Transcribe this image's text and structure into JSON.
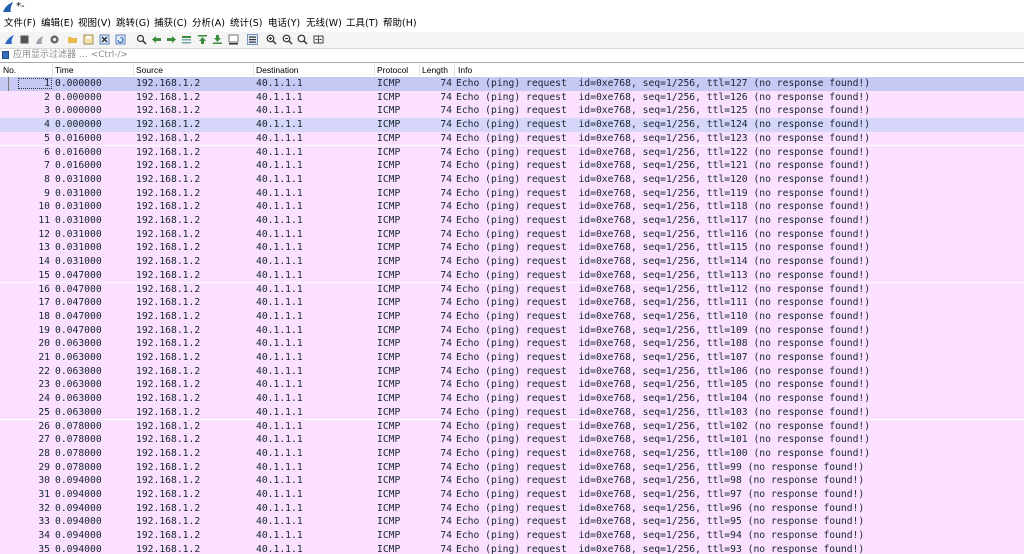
{
  "window": {
    "title": "*-"
  },
  "menu": [
    "文件(F)",
    "编辑(E)",
    "视图(V)",
    "跳转(G)",
    "捕获(C)",
    "分析(A)",
    "统计(S)",
    "电话(Y)",
    "无线(W)",
    "工具(T)",
    "帮助(H)"
  ],
  "toolbar": {
    "icons": [
      "shark-fin-start-icon",
      "stop-icon",
      "restart-icon",
      "options-gear-icon",
      "open-folder-icon",
      "save-icon",
      "close-file-icon",
      "reload-icon",
      "find-icon",
      "go-back-icon",
      "go-forward-icon",
      "go-to-packet-icon",
      "first-packet-icon",
      "last-packet-icon",
      "autoscroll-icon",
      "colorize-icon",
      "zoom-in-icon",
      "zoom-out-icon",
      "normal-size-icon",
      "resize-columns-icon"
    ]
  },
  "filter": {
    "placeholder": "应用显示过滤器 … <Ctrl-/>"
  },
  "columns": {
    "no": "No.",
    "time": "Time",
    "source": "Source",
    "destination": "Destination",
    "protocol": "Protocol",
    "length": "Length",
    "info": "Info"
  },
  "packets": [
    {
      "no": "1",
      "time": "0.000000",
      "src": "192.168.1.2",
      "dst": "40.1.1.1",
      "proto": "ICMP",
      "len": "74",
      "info": "Echo (ping) request  id=0xe768, seq=1/256, ttl=127 (no response found!)"
    },
    {
      "no": "2",
      "time": "0.000000",
      "src": "192.168.1.2",
      "dst": "40.1.1.1",
      "proto": "ICMP",
      "len": "74",
      "info": "Echo (ping) request  id=0xe768, seq=1/256, ttl=126 (no response found!)"
    },
    {
      "no": "3",
      "time": "0.000000",
      "src": "192.168.1.2",
      "dst": "40.1.1.1",
      "proto": "ICMP",
      "len": "74",
      "info": "Echo (ping) request  id=0xe768, seq=1/256, ttl=125 (no response found!)"
    },
    {
      "no": "4",
      "time": "0.000000",
      "src": "192.168.1.2",
      "dst": "40.1.1.1",
      "proto": "ICMP",
      "len": "74",
      "info": "Echo (ping) request  id=0xe768, seq=1/256, ttl=124 (no response found!)"
    },
    {
      "no": "5",
      "time": "0.016000",
      "src": "192.168.1.2",
      "dst": "40.1.1.1",
      "proto": "ICMP",
      "len": "74",
      "info": "Echo (ping) request  id=0xe768, seq=1/256, ttl=123 (no response found!)"
    },
    {
      "no": "6",
      "time": "0.016000",
      "src": "192.168.1.2",
      "dst": "40.1.1.1",
      "proto": "ICMP",
      "len": "74",
      "info": "Echo (ping) request  id=0xe768, seq=1/256, ttl=122 (no response found!)"
    },
    {
      "no": "7",
      "time": "0.016000",
      "src": "192.168.1.2",
      "dst": "40.1.1.1",
      "proto": "ICMP",
      "len": "74",
      "info": "Echo (ping) request  id=0xe768, seq=1/256, ttl=121 (no response found!)"
    },
    {
      "no": "8",
      "time": "0.031000",
      "src": "192.168.1.2",
      "dst": "40.1.1.1",
      "proto": "ICMP",
      "len": "74",
      "info": "Echo (ping) request  id=0xe768, seq=1/256, ttl=120 (no response found!)"
    },
    {
      "no": "9",
      "time": "0.031000",
      "src": "192.168.1.2",
      "dst": "40.1.1.1",
      "proto": "ICMP",
      "len": "74",
      "info": "Echo (ping) request  id=0xe768, seq=1/256, ttl=119 (no response found!)"
    },
    {
      "no": "10",
      "time": "0.031000",
      "src": "192.168.1.2",
      "dst": "40.1.1.1",
      "proto": "ICMP",
      "len": "74",
      "info": "Echo (ping) request  id=0xe768, seq=1/256, ttl=118 (no response found!)"
    },
    {
      "no": "11",
      "time": "0.031000",
      "src": "192.168.1.2",
      "dst": "40.1.1.1",
      "proto": "ICMP",
      "len": "74",
      "info": "Echo (ping) request  id=0xe768, seq=1/256, ttl=117 (no response found!)"
    },
    {
      "no": "12",
      "time": "0.031000",
      "src": "192.168.1.2",
      "dst": "40.1.1.1",
      "proto": "ICMP",
      "len": "74",
      "info": "Echo (ping) request  id=0xe768, seq=1/256, ttl=116 (no response found!)"
    },
    {
      "no": "13",
      "time": "0.031000",
      "src": "192.168.1.2",
      "dst": "40.1.1.1",
      "proto": "ICMP",
      "len": "74",
      "info": "Echo (ping) request  id=0xe768, seq=1/256, ttl=115 (no response found!)"
    },
    {
      "no": "14",
      "time": "0.031000",
      "src": "192.168.1.2",
      "dst": "40.1.1.1",
      "proto": "ICMP",
      "len": "74",
      "info": "Echo (ping) request  id=0xe768, seq=1/256, ttl=114 (no response found!)"
    },
    {
      "no": "15",
      "time": "0.047000",
      "src": "192.168.1.2",
      "dst": "40.1.1.1",
      "proto": "ICMP",
      "len": "74",
      "info": "Echo (ping) request  id=0xe768, seq=1/256, ttl=113 (no response found!)"
    },
    {
      "no": "16",
      "time": "0.047000",
      "src": "192.168.1.2",
      "dst": "40.1.1.1",
      "proto": "ICMP",
      "len": "74",
      "info": "Echo (ping) request  id=0xe768, seq=1/256, ttl=112 (no response found!)"
    },
    {
      "no": "17",
      "time": "0.047000",
      "src": "192.168.1.2",
      "dst": "40.1.1.1",
      "proto": "ICMP",
      "len": "74",
      "info": "Echo (ping) request  id=0xe768, seq=1/256, ttl=111 (no response found!)"
    },
    {
      "no": "18",
      "time": "0.047000",
      "src": "192.168.1.2",
      "dst": "40.1.1.1",
      "proto": "ICMP",
      "len": "74",
      "info": "Echo (ping) request  id=0xe768, seq=1/256, ttl=110 (no response found!)"
    },
    {
      "no": "19",
      "time": "0.047000",
      "src": "192.168.1.2",
      "dst": "40.1.1.1",
      "proto": "ICMP",
      "len": "74",
      "info": "Echo (ping) request  id=0xe768, seq=1/256, ttl=109 (no response found!)"
    },
    {
      "no": "20",
      "time": "0.063000",
      "src": "192.168.1.2",
      "dst": "40.1.1.1",
      "proto": "ICMP",
      "len": "74",
      "info": "Echo (ping) request  id=0xe768, seq=1/256, ttl=108 (no response found!)"
    },
    {
      "no": "21",
      "time": "0.063000",
      "src": "192.168.1.2",
      "dst": "40.1.1.1",
      "proto": "ICMP",
      "len": "74",
      "info": "Echo (ping) request  id=0xe768, seq=1/256, ttl=107 (no response found!)"
    },
    {
      "no": "22",
      "time": "0.063000",
      "src": "192.168.1.2",
      "dst": "40.1.1.1",
      "proto": "ICMP",
      "len": "74",
      "info": "Echo (ping) request  id=0xe768, seq=1/256, ttl=106 (no response found!)"
    },
    {
      "no": "23",
      "time": "0.063000",
      "src": "192.168.1.2",
      "dst": "40.1.1.1",
      "proto": "ICMP",
      "len": "74",
      "info": "Echo (ping) request  id=0xe768, seq=1/256, ttl=105 (no response found!)"
    },
    {
      "no": "24",
      "time": "0.063000",
      "src": "192.168.1.2",
      "dst": "40.1.1.1",
      "proto": "ICMP",
      "len": "74",
      "info": "Echo (ping) request  id=0xe768, seq=1/256, ttl=104 (no response found!)"
    },
    {
      "no": "25",
      "time": "0.063000",
      "src": "192.168.1.2",
      "dst": "40.1.1.1",
      "proto": "ICMP",
      "len": "74",
      "info": "Echo (ping) request  id=0xe768, seq=1/256, ttl=103 (no response found!)"
    },
    {
      "no": "26",
      "time": "0.078000",
      "src": "192.168.1.2",
      "dst": "40.1.1.1",
      "proto": "ICMP",
      "len": "74",
      "info": "Echo (ping) request  id=0xe768, seq=1/256, ttl=102 (no response found!)"
    },
    {
      "no": "27",
      "time": "0.078000",
      "src": "192.168.1.2",
      "dst": "40.1.1.1",
      "proto": "ICMP",
      "len": "74",
      "info": "Echo (ping) request  id=0xe768, seq=1/256, ttl=101 (no response found!)"
    },
    {
      "no": "28",
      "time": "0.078000",
      "src": "192.168.1.2",
      "dst": "40.1.1.1",
      "proto": "ICMP",
      "len": "74",
      "info": "Echo (ping) request  id=0xe768, seq=1/256, ttl=100 (no response found!)"
    },
    {
      "no": "29",
      "time": "0.078000",
      "src": "192.168.1.2",
      "dst": "40.1.1.1",
      "proto": "ICMP",
      "len": "74",
      "info": "Echo (ping) request  id=0xe768, seq=1/256, ttl=99 (no response found!)"
    },
    {
      "no": "30",
      "time": "0.094000",
      "src": "192.168.1.2",
      "dst": "40.1.1.1",
      "proto": "ICMP",
      "len": "74",
      "info": "Echo (ping) request  id=0xe768, seq=1/256, ttl=98 (no response found!)"
    },
    {
      "no": "31",
      "time": "0.094000",
      "src": "192.168.1.2",
      "dst": "40.1.1.1",
      "proto": "ICMP",
      "len": "74",
      "info": "Echo (ping) request  id=0xe768, seq=1/256, ttl=97 (no response found!)"
    },
    {
      "no": "32",
      "time": "0.094000",
      "src": "192.168.1.2",
      "dst": "40.1.1.1",
      "proto": "ICMP",
      "len": "74",
      "info": "Echo (ping) request  id=0xe768, seq=1/256, ttl=96 (no response found!)"
    },
    {
      "no": "33",
      "time": "0.094000",
      "src": "192.168.1.2",
      "dst": "40.1.1.1",
      "proto": "ICMP",
      "len": "74",
      "info": "Echo (ping) request  id=0xe768, seq=1/256, ttl=95 (no response found!)"
    },
    {
      "no": "34",
      "time": "0.094000",
      "src": "192.168.1.2",
      "dst": "40.1.1.1",
      "proto": "ICMP",
      "len": "74",
      "info": "Echo (ping) request  id=0xe768, seq=1/256, ttl=94 (no response found!)"
    },
    {
      "no": "35",
      "time": "0.094000",
      "src": "192.168.1.2",
      "dst": "40.1.1.1",
      "proto": "ICMP",
      "len": "74",
      "info": "Echo (ping) request  id=0xe768, seq=1/256, ttl=93 (no response found!)"
    }
  ],
  "selected_packet": "1",
  "highlighted_packet": "4",
  "colors": {
    "row_icmp": "#fce0ff",
    "row_selected": "#c8c8f5",
    "row_highlight": "#d6d6fa",
    "text": "#12272e"
  }
}
